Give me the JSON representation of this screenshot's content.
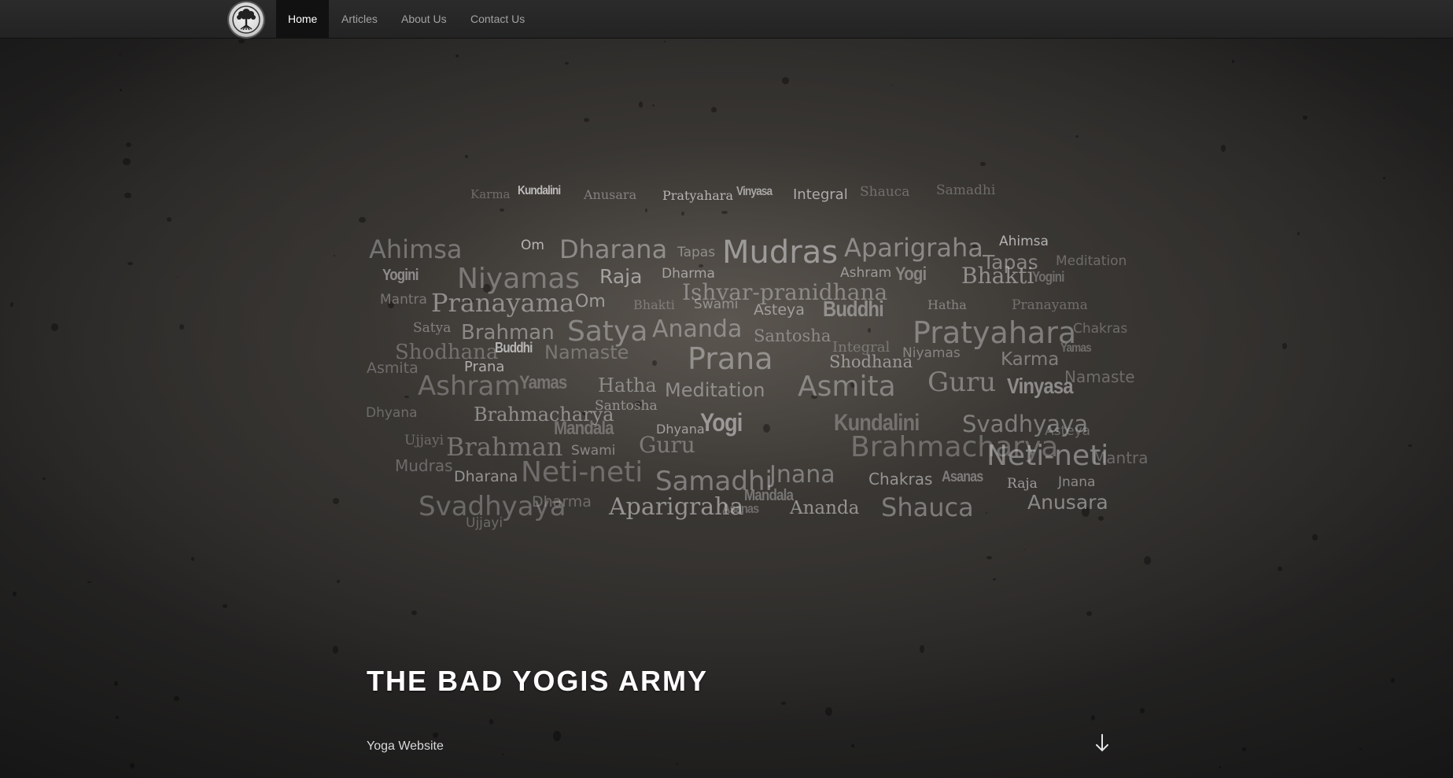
{
  "nav": {
    "items": [
      {
        "label": "Home",
        "active": true
      },
      {
        "label": "Articles",
        "active": false
      },
      {
        "label": "About Us",
        "active": false
      },
      {
        "label": "Contact Us",
        "active": false
      }
    ]
  },
  "hero": {
    "title": "THE BAD YOGIS ARMY",
    "subtitle": "Yoga Website"
  },
  "icons": {
    "logo": "tree-of-life-icon",
    "scroll": "arrow-down-icon"
  },
  "colors": {
    "nav_bg": "#262626",
    "nav_active_bg": "#111111",
    "nav_text": "#a2a2a2",
    "nav_active_text": "#ffffff",
    "title_text": "#ffffff"
  },
  "word_cloud": [
    {
      "text": "Karma",
      "font": "serif"
    },
    {
      "text": "Kundalini",
      "font": "condensed"
    },
    {
      "text": "Anusara",
      "font": "serif"
    },
    {
      "text": "Pratyahara",
      "font": "serif"
    },
    {
      "text": "Vinyasa",
      "font": "condensed"
    },
    {
      "text": "Integral",
      "font": "sans"
    },
    {
      "text": "Shauca",
      "font": "serif"
    },
    {
      "text": "Samadhi",
      "font": "serif"
    },
    {
      "text": "Ahimsa",
      "font": "sans"
    },
    {
      "text": "Om",
      "font": "sans"
    },
    {
      "text": "Dharana",
      "font": "sans"
    },
    {
      "text": "Tapas",
      "font": "sans"
    },
    {
      "text": "Mudras",
      "font": "sans"
    },
    {
      "text": "Aparigraha",
      "font": "sans"
    },
    {
      "text": "Ahimsa",
      "font": "sans"
    },
    {
      "text": "Tapas",
      "font": "sans"
    },
    {
      "text": "Meditation",
      "font": "sans"
    },
    {
      "text": "Yogini",
      "font": "condensed"
    },
    {
      "text": "Niyamas",
      "font": "sans"
    },
    {
      "text": "Raja",
      "font": "sans"
    },
    {
      "text": "Dharma",
      "font": "sans"
    },
    {
      "text": "Ashram",
      "font": "sans"
    },
    {
      "text": "Yogi",
      "font": "condensed"
    },
    {
      "text": "Bhakti",
      "font": "serif"
    },
    {
      "text": "Yogini",
      "font": "condensed"
    },
    {
      "text": "Mantra",
      "font": "sans"
    },
    {
      "text": "Pranayama",
      "font": "serif"
    },
    {
      "text": "Om",
      "font": "sans"
    },
    {
      "text": "Bhakti",
      "font": "serif"
    },
    {
      "text": "Swami",
      "font": "sans"
    },
    {
      "text": "Ishvar-pranidhana",
      "font": "serif"
    },
    {
      "text": "Asteya",
      "font": "sans"
    },
    {
      "text": "Buddhi",
      "font": "condensed"
    },
    {
      "text": "Hatha",
      "font": "serif"
    },
    {
      "text": "Pranayama",
      "font": "serif"
    },
    {
      "text": "Satya",
      "font": "serif"
    },
    {
      "text": "Brahman",
      "font": "sans"
    },
    {
      "text": "Satya",
      "font": "sans"
    },
    {
      "text": "Ananda",
      "font": "sans"
    },
    {
      "text": "Santosha",
      "font": "serif"
    },
    {
      "text": "Pratyahara",
      "font": "sans"
    },
    {
      "text": "Chakras",
      "font": "sans"
    },
    {
      "text": "Shodhana",
      "font": "serif"
    },
    {
      "text": "Buddhi",
      "font": "condensed"
    },
    {
      "text": "Namaste",
      "font": "sans"
    },
    {
      "text": "Integral",
      "font": "serif"
    },
    {
      "text": "Prana",
      "font": "sans"
    },
    {
      "text": "Shodhana",
      "font": "serif"
    },
    {
      "text": "Niyamas",
      "font": "sans"
    },
    {
      "text": "Karma",
      "font": "sans"
    },
    {
      "text": "Yamas",
      "font": "condensed"
    },
    {
      "text": "Asmita",
      "font": "sans"
    },
    {
      "text": "Prana",
      "font": "sans"
    },
    {
      "text": "Ashram",
      "font": "sans"
    },
    {
      "text": "Yamas",
      "font": "condensed"
    },
    {
      "text": "Hatha",
      "font": "serif"
    },
    {
      "text": "Meditation",
      "font": "sans"
    },
    {
      "text": "Asmita",
      "font": "sans"
    },
    {
      "text": "Guru",
      "font": "serif"
    },
    {
      "text": "Vinyasa",
      "font": "condensed"
    },
    {
      "text": "Namaste",
      "font": "sans"
    },
    {
      "text": "Santosha",
      "font": "serif"
    },
    {
      "text": "Dhyana",
      "font": "sans"
    },
    {
      "text": "Brahmacharya",
      "font": "serif"
    },
    {
      "text": "Mandala",
      "font": "condensed"
    },
    {
      "text": "Dhyana",
      "font": "sans"
    },
    {
      "text": "Yogi",
      "font": "condensed"
    },
    {
      "text": "Kundalini",
      "font": "condensed"
    },
    {
      "text": "Svadhyaya",
      "font": "sans"
    },
    {
      "text": "Asteya",
      "font": "sans"
    },
    {
      "text": "Ujjayi",
      "font": "serif"
    },
    {
      "text": "Brahman",
      "font": "serif"
    },
    {
      "text": "Swami",
      "font": "sans"
    },
    {
      "text": "Guru",
      "font": "serif"
    },
    {
      "text": "Brahmacharya",
      "font": "sans"
    },
    {
      "text": "Neti-neti",
      "font": "sans"
    },
    {
      "text": "Mantra",
      "font": "sans"
    },
    {
      "text": "Mudras",
      "font": "sans"
    },
    {
      "text": "Dharana",
      "font": "sans"
    },
    {
      "text": "Neti-neti",
      "font": "sans"
    },
    {
      "text": "Samadhi",
      "font": "sans"
    },
    {
      "text": "Jnana",
      "font": "sans"
    },
    {
      "text": "Chakras",
      "font": "sans"
    },
    {
      "text": "Asanas",
      "font": "condensed"
    },
    {
      "text": "Raja",
      "font": "serif"
    },
    {
      "text": "Jnana",
      "font": "sans"
    },
    {
      "text": "Mandala",
      "font": "condensed"
    },
    {
      "text": "Svadhyaya",
      "font": "sans"
    },
    {
      "text": "Dharma",
      "font": "sans"
    },
    {
      "text": "Aparigraha",
      "font": "serif"
    },
    {
      "text": "Asanas",
      "font": "condensed"
    },
    {
      "text": "Ananda",
      "font": "serif"
    },
    {
      "text": "Shauca",
      "font": "sans"
    },
    {
      "text": "Anusara",
      "font": "sans"
    },
    {
      "text": "Ujjayi",
      "font": "sans"
    },
    {
      "text": "Ishvar-pranidhana",
      "font": "serif"
    }
  ]
}
